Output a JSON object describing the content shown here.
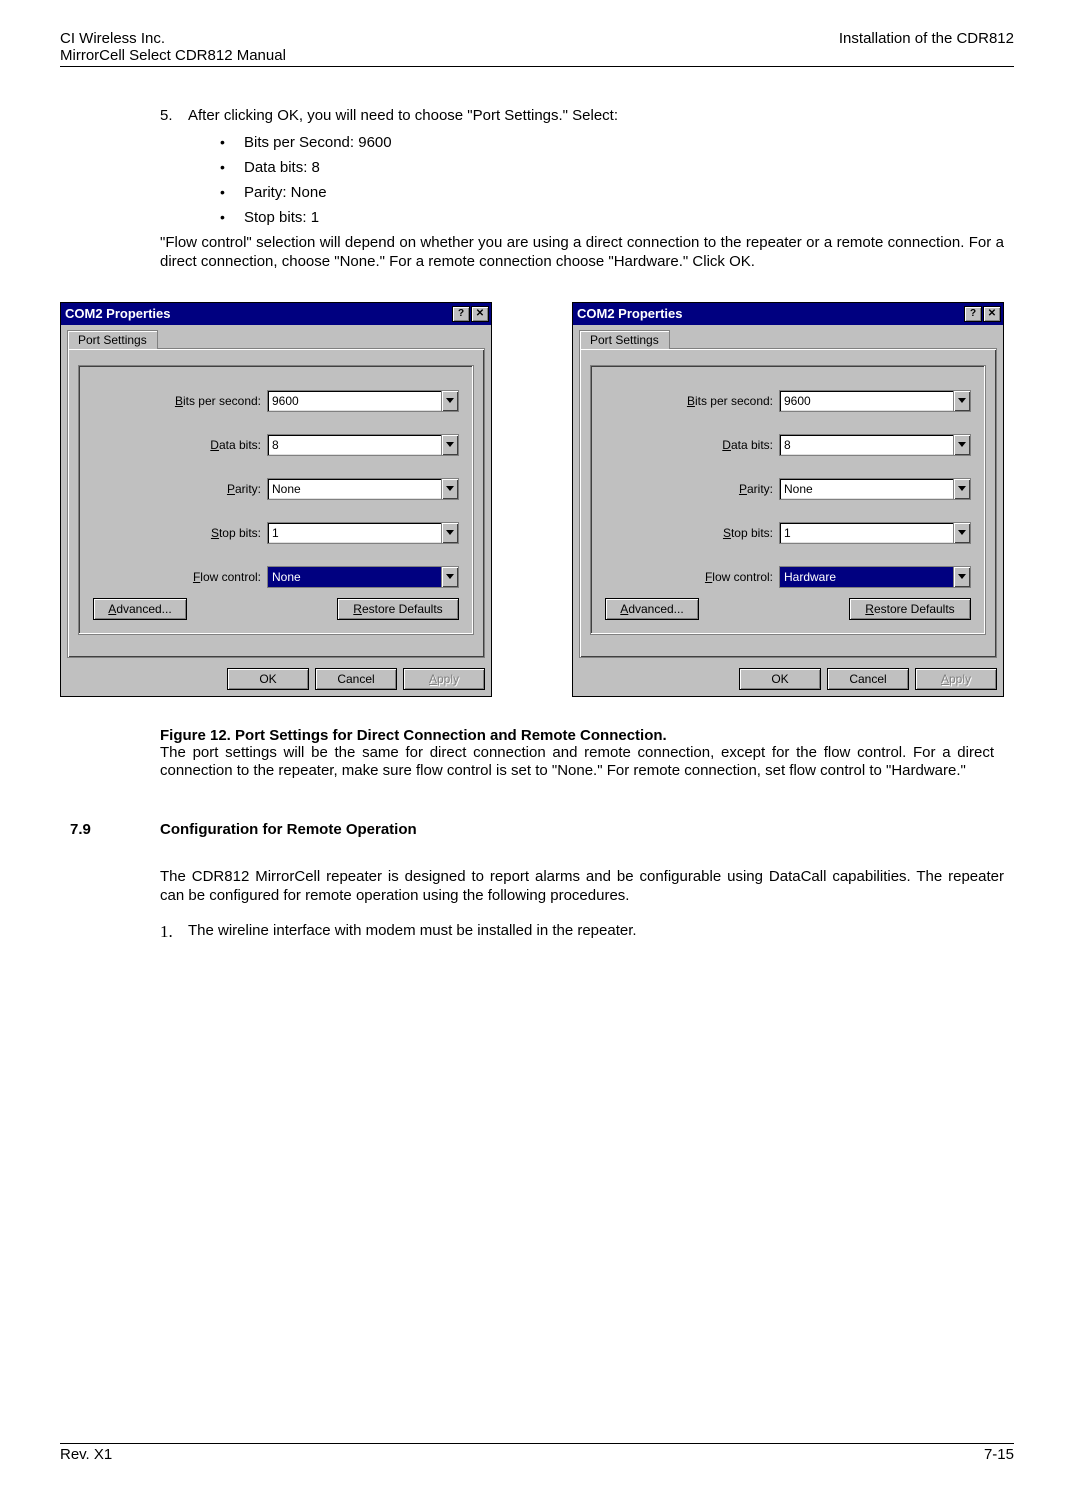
{
  "header": {
    "left1": "CI Wireless Inc.",
    "right1": "Installation of the CDR812",
    "left2": "MirrorCell Select CDR812 Manual"
  },
  "step5": {
    "num": "5.",
    "text": "After clicking OK, you will need to choose \"Port Settings.\" Select:"
  },
  "bullets": [
    "Bits per Second: 9600",
    "Data bits: 8",
    "Parity: None",
    "Stop bits: 1"
  ],
  "flow_para": " \"Flow control\" selection will depend on whether you are using a direct connection to the repeater or a remote connection. For a direct connection, choose \"None.\" For a remote connection choose \"Hardware.\" Click OK.",
  "dialog": {
    "title": "COM2 Properties",
    "tab": "Port Settings",
    "labels": {
      "bits": "its per second:",
      "data": "ata bits:",
      "parity": "arity:",
      "stop": "top bits:",
      "flow": "low control:"
    },
    "prefix": {
      "bits": "B",
      "data": "D",
      "parity": "P",
      "stop": "S",
      "flow": "F"
    },
    "values": {
      "bits": "9600",
      "data": "8",
      "parity": "None",
      "stop": "1",
      "flow_left": "None",
      "flow_right": "Hardware"
    },
    "buttons": {
      "advanced": "dvanced...",
      "adv_prefix": "A",
      "restore": "estore Defaults",
      "restore_prefix": "R",
      "ok": "OK",
      "cancel": "Cancel",
      "apply": "pply",
      "apply_prefix": "A"
    }
  },
  "figure": {
    "title": "Figure 12. Port Settings for Direct Connection and Remote Connection.",
    "text": "The port settings will be the same for direct connection and remote connection, except for the flow control. For a direct connection to the repeater, make sure flow control is set to \"None.\" For remote connection, set flow control to \"Hardware.\""
  },
  "section": {
    "num": "7.9",
    "title": "Configuration for Remote Operation",
    "para": "The CDR812 MirrorCell repeater is designed to report alarms and be configurable using DataCall capabilities. The repeater can be configured for remote operation using the following procedures.",
    "step1_num": "1.",
    "step1_text": "The wireline interface with modem must be installed in the repeater."
  },
  "footer": {
    "left": "Rev. X1",
    "right": "7-15"
  }
}
